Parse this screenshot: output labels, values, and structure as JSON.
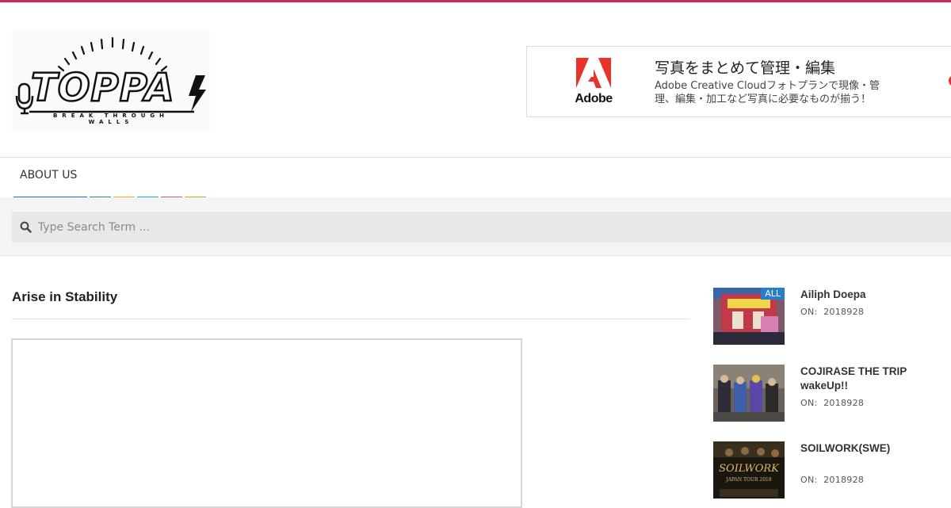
{
  "brand": {
    "logo_word": "TOPPA",
    "logo_tagline": "BREAK THROUGH WALLS",
    "accent_color": "#c8285a"
  },
  "ad": {
    "brand": "Adobe",
    "title": "写真をまとめて管理・編集",
    "description": "Adobe Creative Cloudフォトプランで現像・管理、編集・加工など写真に必要なものが揃う！",
    "brand_color": "#e8332a"
  },
  "nav": {
    "items": [
      {
        "label": "ABOUT US"
      }
    ],
    "stripe_colors": [
      "#2c6fb6",
      "#2e9b3e",
      "#e7b424",
      "#28a9c9",
      "#d9539a",
      "#b5b820"
    ]
  },
  "search": {
    "icon": "search-icon",
    "placeholder": "Type Search Term ..."
  },
  "post": {
    "title": "Arise in Stability"
  },
  "sidebar": {
    "items": [
      {
        "title": "Ailiph Doepa",
        "date_prefix": "ON:",
        "date": "2018928",
        "tag": "ALL"
      },
      {
        "title": "COJIRASE THE TRIP\nwakeUp!!",
        "date_prefix": "ON:",
        "date": "2018928"
      },
      {
        "title": "SOILWORK(SWE)",
        "date_prefix": "ON:",
        "date": "2018928",
        "thumb_text": "SOILWORK",
        "thumb_subtext": "JAPAN TOUR 2018"
      }
    ]
  }
}
